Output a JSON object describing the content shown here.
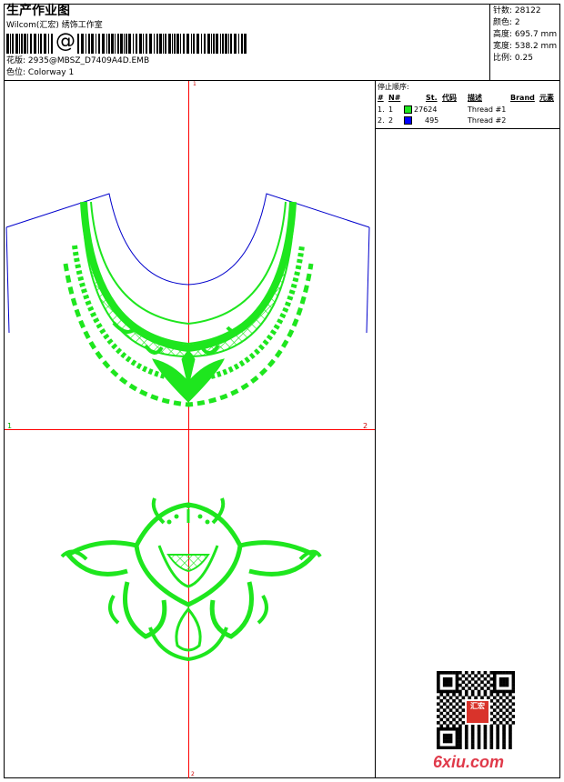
{
  "header": {
    "title": "生产作业图",
    "studio": "Wilcom(汇宏) 绣饰工作室",
    "barcode_symbol": "@",
    "design_label": "花版:",
    "design_value": "2935@MBSZ_D7409A4D.EMB",
    "colorway_label": "色位:",
    "colorway_value": "Colorway 1"
  },
  "stats": {
    "stitches_label": "针数:",
    "stitches_value": "28122",
    "colors_label": "颜色:",
    "colors_value": "2",
    "height_label": "高度:",
    "height_value": "695.7 mm",
    "width_label": "宽度:",
    "width_value": "538.2 mm",
    "scale_label": "比例:",
    "scale_value": "0.25"
  },
  "stop_sequence": {
    "title": "停止顺序:",
    "columns": [
      "#",
      "N#",
      "St.",
      "代码",
      "描述",
      "Brand",
      "元素"
    ],
    "rows": [
      {
        "index": "1.",
        "n": "1",
        "color": "#1ee61e",
        "stitches": "27624",
        "code": "",
        "desc": "Thread #1"
      },
      {
        "index": "2.",
        "n": "2",
        "color": "#0000ff",
        "stitches": "495",
        "code": "",
        "desc": "Thread #2"
      }
    ]
  },
  "canvas": {
    "marker_left": "1",
    "marker_right": "2",
    "marker_top": "1",
    "marker_bottom": "2",
    "embroidery_color": "#1ee61e",
    "outline_color": "#0000cc",
    "axis_color": "#ff0000"
  },
  "watermark": {
    "site": "6xiu.com",
    "stamp": "汇宏"
  }
}
